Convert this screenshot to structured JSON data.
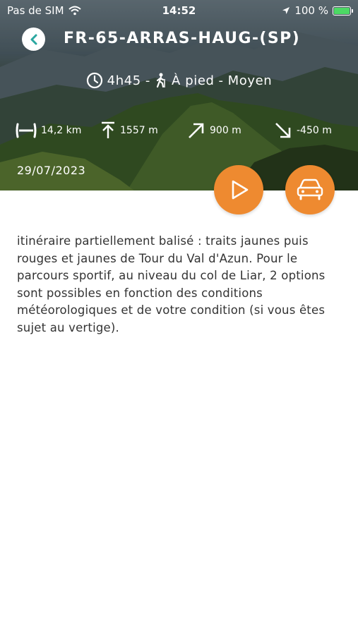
{
  "status_bar": {
    "carrier": "Pas de SIM",
    "time": "14:52",
    "battery": "100 %"
  },
  "hike": {
    "title": "FR-65-ARRAS-HAUG-(SP)",
    "duration": "4h45",
    "separator": "-",
    "mode": "À pied",
    "difficulty": "Moyen",
    "distance": "14,2 km",
    "max_altitude": "1557 m",
    "ascent": "900 m",
    "descent": "-450 m",
    "date": "29/07/2023",
    "description": "itinéraire partiellement balisé : traits jaunes puis rouges et jaunes de Tour du Val d'Azun. Pour le parcours sportif, au niveau du col de Liar, 2 options sont possibles en fonction des conditions météorologiques et de votre condition (si vous êtes sujet au vertige)."
  },
  "colors": {
    "accent": "#ee8a30",
    "back_icon": "#2aa7a0",
    "text": "#333333"
  }
}
